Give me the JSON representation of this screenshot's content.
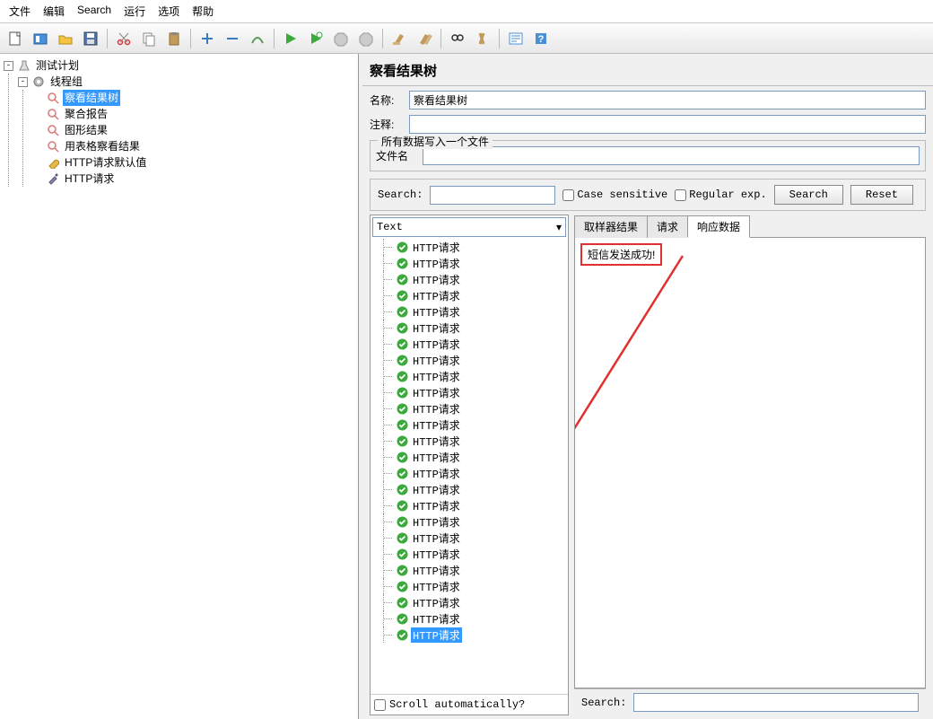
{
  "menu": [
    "文件",
    "编辑",
    "Search",
    "运行",
    "选项",
    "帮助"
  ],
  "tree": {
    "root": "测试计划",
    "group": "线程组",
    "children": [
      {
        "label": "察看结果树",
        "selected": true,
        "icon": "glass"
      },
      {
        "label": "聚合报告",
        "selected": false,
        "icon": "glass"
      },
      {
        "label": "图形结果",
        "selected": false,
        "icon": "glass"
      },
      {
        "label": "用表格察看结果",
        "selected": false,
        "icon": "glass"
      },
      {
        "label": "HTTP请求默认值",
        "selected": false,
        "icon": "wrench"
      },
      {
        "label": "HTTP请求",
        "selected": false,
        "icon": "dropper"
      }
    ]
  },
  "panel": {
    "title": "察看结果树",
    "name_label": "名称:",
    "name_value": "察看结果树",
    "comment_label": "注释:",
    "comment_value": "",
    "file_group_title": "所有数据写入一个文件",
    "file_label": "文件名",
    "file_value": ""
  },
  "search_bar": {
    "label": "Search:",
    "value": "",
    "case_label": "Case sensitive",
    "regex_label": "Regular exp.",
    "search_btn": "Search",
    "reset_btn": "Reset"
  },
  "results": {
    "dropdown": "Text",
    "item_label": "HTTP请求",
    "count": 25,
    "selected_index": 24,
    "scroll_auto": "Scroll automatically?"
  },
  "tabs": {
    "items": [
      "取样器结果",
      "请求",
      "响应数据"
    ],
    "active": 2
  },
  "response": {
    "body": "短信发送成功!"
  },
  "bottom_search": {
    "label": "Search:",
    "value": ""
  }
}
